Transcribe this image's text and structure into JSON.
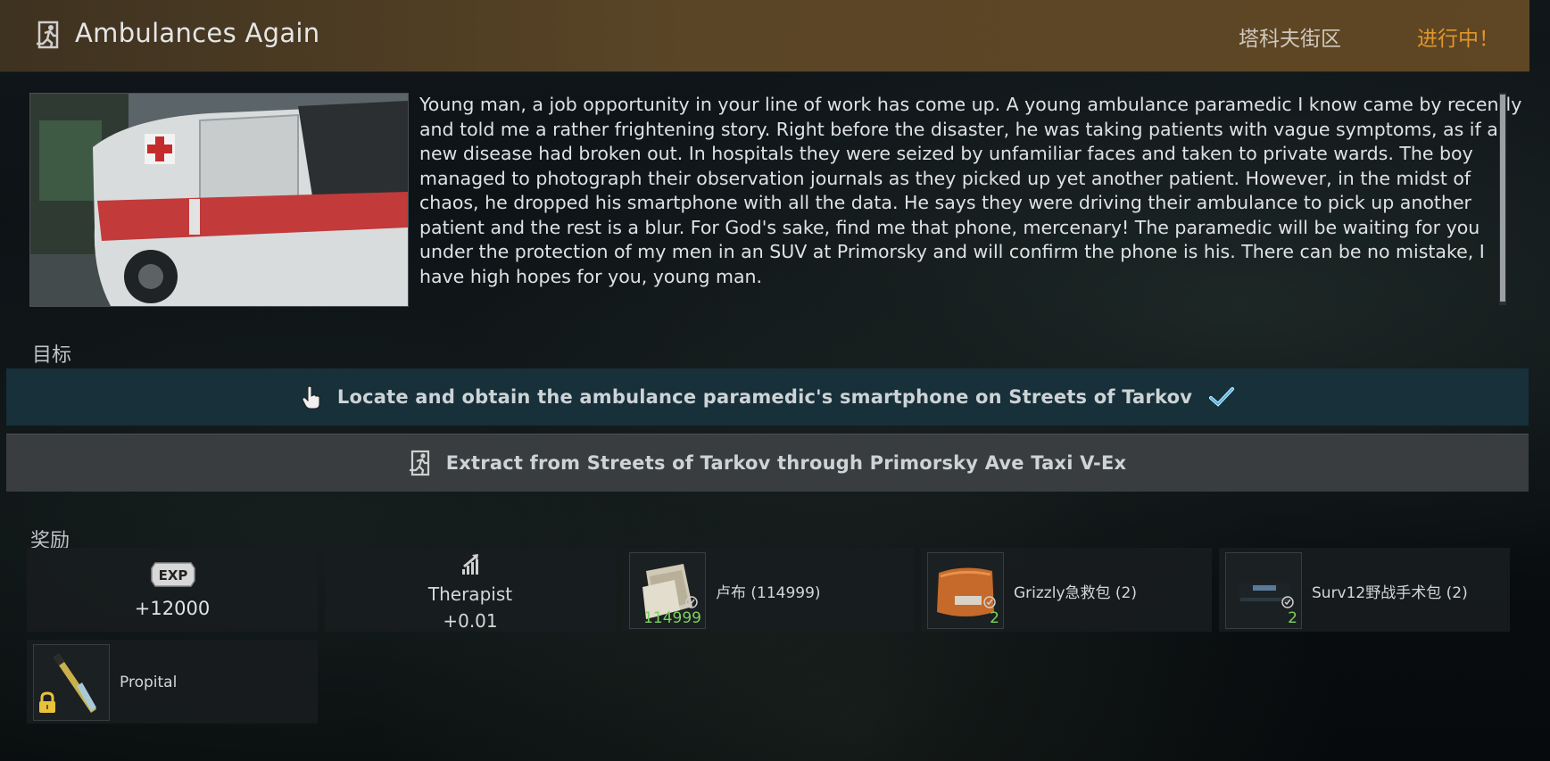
{
  "header": {
    "title": "Ambulances Again",
    "location": "塔科夫街区",
    "status": "进行中！",
    "status_color": "#e0962a",
    "icon": "quest-exit-icon"
  },
  "description": {
    "text": "Young man, a job opportunity in your line of work has come up. A young ambulance paramedic I know came by recently and told me a rather frightening story. Right before the disaster, he was taking patients with vague symptoms, as if a new disease had broken out. In hospitals they were seized by unfamiliar faces and taken to private wards. The boy managed to photograph their observation journals as they picked up yet another patient. However, in the midst of chaos, he dropped his smartphone with all the data. He says they were driving their ambulance to pick up another patient and the rest is a blur. For God's sake, find me that phone, mercenary! The paramedic will be waiting for you under the protection of my men in an SUV at Primorsky and will confirm the phone is his. There can be no mistake, I have high hopes for you, young man.",
    "image": "ambulance-image"
  },
  "objectives": {
    "label": "目标",
    "items": [
      {
        "text": "Locate and obtain the ambulance paramedic's smartphone on Streets of Tarkov",
        "icon": "hand-pointer-icon",
        "completed": true
      },
      {
        "text": "Extract from Streets of Tarkov through Primorsky Ave Taxi V-Ex",
        "icon": "exit-icon",
        "completed": false
      }
    ]
  },
  "rewards": {
    "label": "奖励",
    "exp": {
      "icon_text": "EXP",
      "value": "+12000"
    },
    "standing": {
      "trader": "Therapist",
      "value": "+0.01",
      "icon": "standing-up-icon"
    },
    "items": [
      {
        "name": "卢布 (114999)",
        "count": "114999",
        "icon": "roubles-icon"
      },
      {
        "name": "Grizzly急救包 (2)",
        "count": "2",
        "icon": "grizzly-medkit-icon"
      },
      {
        "name": "Surv12野战手术包 (2)",
        "count": "2",
        "icon": "surv12-kit-icon"
      }
    ],
    "unlock": {
      "name": "Propital",
      "icon": "propital-injector-icon"
    }
  }
}
